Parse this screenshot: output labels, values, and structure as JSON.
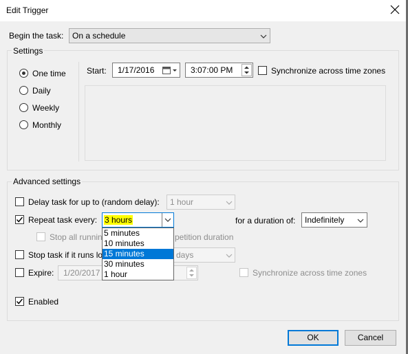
{
  "window": {
    "title": "Edit Trigger"
  },
  "begin": {
    "label": "Begin the task:",
    "value": "On a schedule"
  },
  "settings": {
    "legend": "Settings",
    "radios": [
      {
        "label": "One time",
        "checked": true
      },
      {
        "label": "Daily",
        "checked": false
      },
      {
        "label": "Weekly",
        "checked": false
      },
      {
        "label": "Monthly",
        "checked": false
      }
    ],
    "start_label": "Start:",
    "start_date": "1/17/2016",
    "start_time": "3:07:00 PM",
    "sync_label": "Synchronize across time zones"
  },
  "advanced": {
    "legend": "Advanced settings",
    "delay_label": "Delay task for up to (random delay):",
    "delay_value": "1 hour",
    "repeat_label": "Repeat task every:",
    "repeat_value": "3 hours",
    "repeat_options": [
      "5 minutes",
      "10 minutes",
      "15 minutes",
      "30 minutes",
      "1 hour"
    ],
    "repeat_hover_index": 2,
    "duration_label": "for a duration of:",
    "duration_value": "Indefinitely",
    "stop_all_label_left": "Stop all runnin",
    "stop_all_label_right": "petition duration",
    "stop_task_label": "Stop task if it runs lo",
    "stop_task_value": "days",
    "expire_label": "Expire:",
    "expire_date": "1/20/2017",
    "expire_sync_label": "Synchronize across time zones",
    "enabled_label": "Enabled"
  },
  "buttons": {
    "ok": "OK",
    "cancel": "Cancel"
  },
  "colors": {
    "accent": "#0078d7",
    "highlight": "#ffff00"
  }
}
